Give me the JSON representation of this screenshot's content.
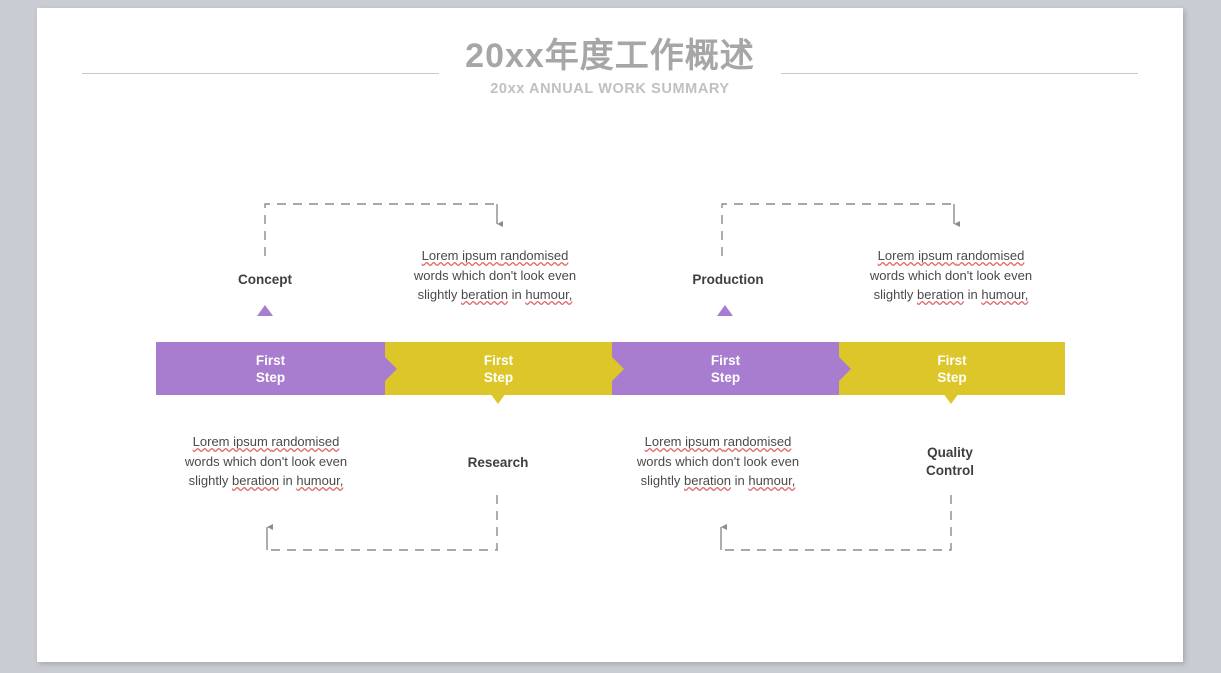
{
  "slide": {
    "background_color": "#ffffff",
    "page_background_color": "#c9ccd2"
  },
  "header": {
    "title": "20xx年度工作概述",
    "subtitle": "20xx ANNUAL WORK SUMMARY",
    "title_color": "#a6a6a6",
    "subtitle_color": "#c0c0c0"
  },
  "colors": {
    "purple": "#a87cce",
    "yellow": "#ddc62a",
    "connector": "#8c8c8c",
    "spellcheck": "#e06666"
  },
  "banner": {
    "segments": [
      {
        "label": "First\nStep",
        "color_name": "purple",
        "color": "#a87cce"
      },
      {
        "label": "First\nStep",
        "color_name": "yellow",
        "color": "#ddc62a"
      },
      {
        "label": "First\nStep",
        "color_name": "purple",
        "color": "#a87cce"
      },
      {
        "label": "First\nStep",
        "color_name": "yellow",
        "color": "#ddc62a"
      }
    ]
  },
  "nodes": [
    {
      "label": "Concept",
      "marker": "up",
      "marker_color": "#a87cce",
      "position": "above"
    },
    {
      "label": "Research",
      "marker": "down",
      "marker_color": "#ddc62a",
      "position": "below"
    },
    {
      "label": "Production",
      "marker": "up",
      "marker_color": "#a87cce",
      "position": "above"
    },
    {
      "label": "Quality\nControl",
      "marker": "down",
      "marker_color": "#ddc62a",
      "position": "below"
    }
  ],
  "paragraphs": [
    {
      "lines": [
        [
          {
            "t": "Lorem ipsum ",
            "sq": true
          },
          {
            "t": "randomised",
            "sq": true
          }
        ],
        [
          {
            "t": "words which don't look even",
            "sq": false
          }
        ],
        [
          {
            "t": "slightly ",
            "sq": false
          },
          {
            "t": "beration",
            "sq": true
          },
          {
            "t": " in ",
            "sq": false
          },
          {
            "t": "humour,",
            "sq": true
          }
        ]
      ],
      "text": "Lorem ipsum randomised words which don't look even slightly beration in humour,"
    },
    {
      "lines": [
        [
          {
            "t": "Lorem ipsum ",
            "sq": true
          },
          {
            "t": "randomised",
            "sq": true
          }
        ],
        [
          {
            "t": "words which don't look even",
            "sq": false
          }
        ],
        [
          {
            "t": "slightly ",
            "sq": false
          },
          {
            "t": "beration",
            "sq": true
          },
          {
            "t": " in ",
            "sq": false
          },
          {
            "t": "humour,",
            "sq": true
          }
        ]
      ],
      "text": "Lorem ipsum randomised words which don't look even slightly beration in humour,"
    },
    {
      "lines": [
        [
          {
            "t": "Lorem ipsum ",
            "sq": true
          },
          {
            "t": "randomised",
            "sq": true
          }
        ],
        [
          {
            "t": "words which don't look even",
            "sq": false
          }
        ],
        [
          {
            "t": "slightly ",
            "sq": false
          },
          {
            "t": "beration",
            "sq": true
          },
          {
            "t": " in ",
            "sq": false
          },
          {
            "t": "humour,",
            "sq": true
          }
        ]
      ],
      "text": "Lorem ipsum randomised words which don't look even slightly beration in humour,"
    },
    {
      "lines": [
        [
          {
            "t": "Lorem ipsum ",
            "sq": true
          },
          {
            "t": "randomised",
            "sq": true
          }
        ],
        [
          {
            "t": "words which don't look even",
            "sq": false
          }
        ],
        [
          {
            "t": "slightly ",
            "sq": false
          },
          {
            "t": "beration",
            "sq": true
          },
          {
            "t": " in ",
            "sq": false
          },
          {
            "t": "humour,",
            "sq": true
          }
        ]
      ],
      "text": "Lorem ipsum randomised words which don't look even slightly beration in humour,"
    }
  ]
}
